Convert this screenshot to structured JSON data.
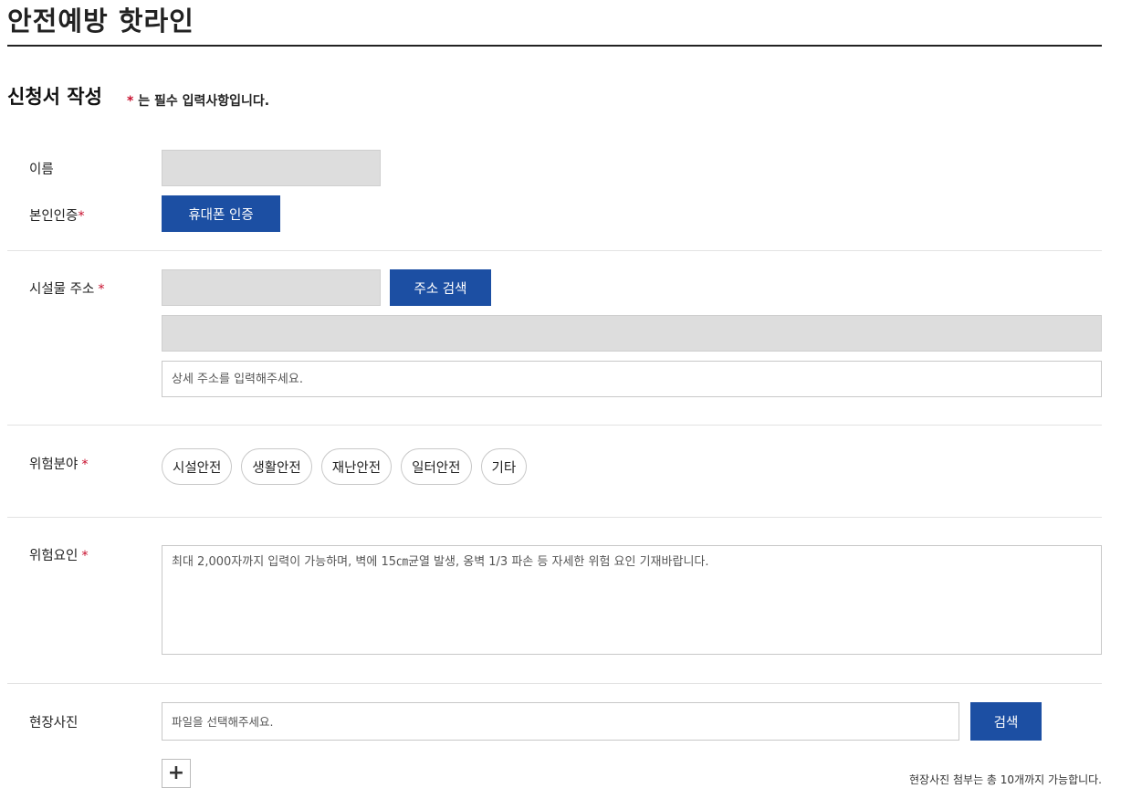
{
  "page_title": "안전예방 핫라인",
  "section_title": "신청서 작성",
  "required_note": {
    "star": "*",
    "text": " 는 필수 입력사항입니다."
  },
  "form": {
    "name": {
      "label": "이름",
      "value": ""
    },
    "verification": {
      "label": "본인인증",
      "star": "*",
      "button": "휴대폰 인증"
    },
    "address": {
      "label": "시설물 주소",
      "star": "*",
      "search_button": "주소 검색",
      "postal_value": "",
      "address_value": "",
      "detail_placeholder": "상세 주소를 입력해주세요."
    },
    "risk_field": {
      "label": "위험분야",
      "star": "*",
      "options": [
        "시설안전",
        "생활안전",
        "재난안전",
        "일터안전",
        "기타"
      ]
    },
    "risk_factor": {
      "label": "위험요인",
      "star": "*",
      "placeholder": "최대 2,000자까지 입력이 가능하며, 벽에 15㎝균열 발생, 옹벽 1/3 파손 등 자세한 위험 요인 기재바랍니다."
    },
    "photo": {
      "label": "현장사진",
      "file_placeholder": "파일을 선택해주세요.",
      "search_button": "검색",
      "add_button": "+",
      "note": "현장사진 첨부는 총 10개까지 가능합니다."
    }
  },
  "colors": {
    "accent_blue": "#1c4fa3",
    "required_red": "#c8102e",
    "readonly_gray": "#dddddd"
  }
}
